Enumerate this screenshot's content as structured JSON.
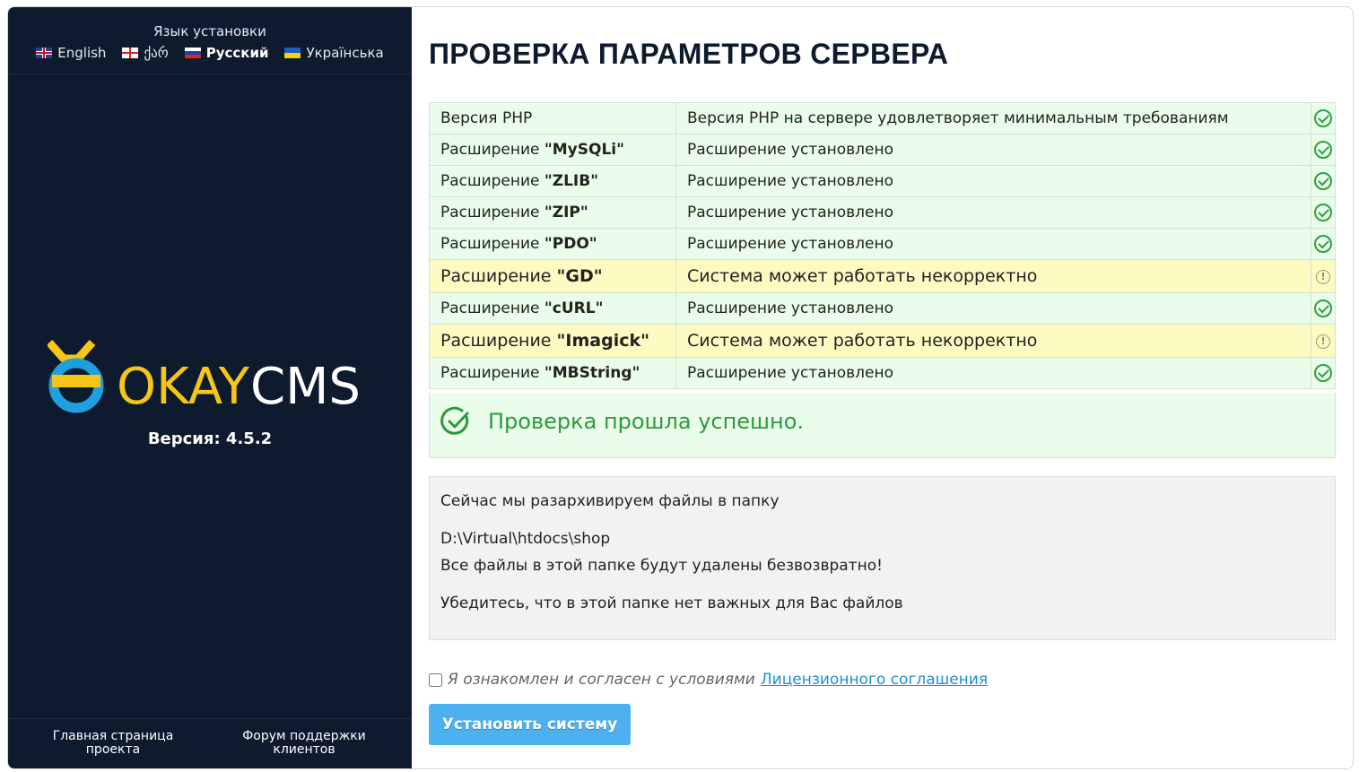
{
  "sidebar": {
    "lang_title": "Язык установки",
    "languages": [
      {
        "label": "English",
        "flag": "gb-flag-icon",
        "active": false
      },
      {
        "label": "ქარ",
        "flag": "ge-flag-icon",
        "active": false
      },
      {
        "label": "Русский",
        "flag": "ru-flag-icon",
        "active": true
      },
      {
        "label": "Українська",
        "flag": "ua-flag-icon",
        "active": false
      }
    ],
    "logo": {
      "okay": "OKAY",
      "cms": "CMS",
      "okay_color": "#f5c518",
      "cms_color": "#ffffff",
      "ring_color": "#1ea0e0"
    },
    "version": "Версия: 4.5.2",
    "footer_links": [
      "Главная страница проекта",
      "Форум поддержки клиентов"
    ]
  },
  "main": {
    "title": "ПРОВЕРКА ПАРАМЕТРОВ СЕРВЕРА",
    "checks": [
      {
        "prefix": "Версия PHP",
        "ext": "",
        "message": "Версия PHP на сервере удовлетворяет минимальным требованиям",
        "status": "ok"
      },
      {
        "prefix": "Расширение ",
        "ext": "\"MySQLi\"",
        "message": "Расширение установлено",
        "status": "ok"
      },
      {
        "prefix": "Расширение ",
        "ext": "\"ZLIB\"",
        "message": "Расширение установлено",
        "status": "ok"
      },
      {
        "prefix": "Расширение ",
        "ext": "\"ZIP\"",
        "message": "Расширение установлено",
        "status": "ok"
      },
      {
        "prefix": "Расширение ",
        "ext": "\"PDO\"",
        "message": "Расширение установлено",
        "status": "ok"
      },
      {
        "prefix": "Расширение ",
        "ext": "\"GD\"",
        "message": "Система может работать некорректно",
        "status": "warn"
      },
      {
        "prefix": "Расширение ",
        "ext": "\"cURL\"",
        "message": "Расширение установлено",
        "status": "ok"
      },
      {
        "prefix": "Расширение ",
        "ext": "\"Imagick\"",
        "message": "Система может работать некорректно",
        "status": "warn"
      },
      {
        "prefix": "Расширение ",
        "ext": "\"MBString\"",
        "message": "Расширение установлено",
        "status": "ok"
      }
    ],
    "success_message": "Проверка прошла успешно.",
    "notice": {
      "line1": "Сейчас мы разархивируем файлы в папку",
      "path": "D:\\Virtual\\htdocs\\shop",
      "line3": "Все файлы в этой папке будут удалены безвозвратно!",
      "line4": "Убедитесь, что в этой папке нет важных для Вас файлов"
    },
    "agree": {
      "text": "Я ознакомлен и согласен с условиями",
      "link": "Лицензионного соглашения",
      "checked": false
    },
    "install_button": "Установить систему",
    "colors": {
      "accent": "#4db0ef",
      "ok": "#2ea043",
      "ok_bg": "#eafdea",
      "warn_bg": "#fdfbc2",
      "sidebar_bg": "#0e1a2e"
    }
  }
}
